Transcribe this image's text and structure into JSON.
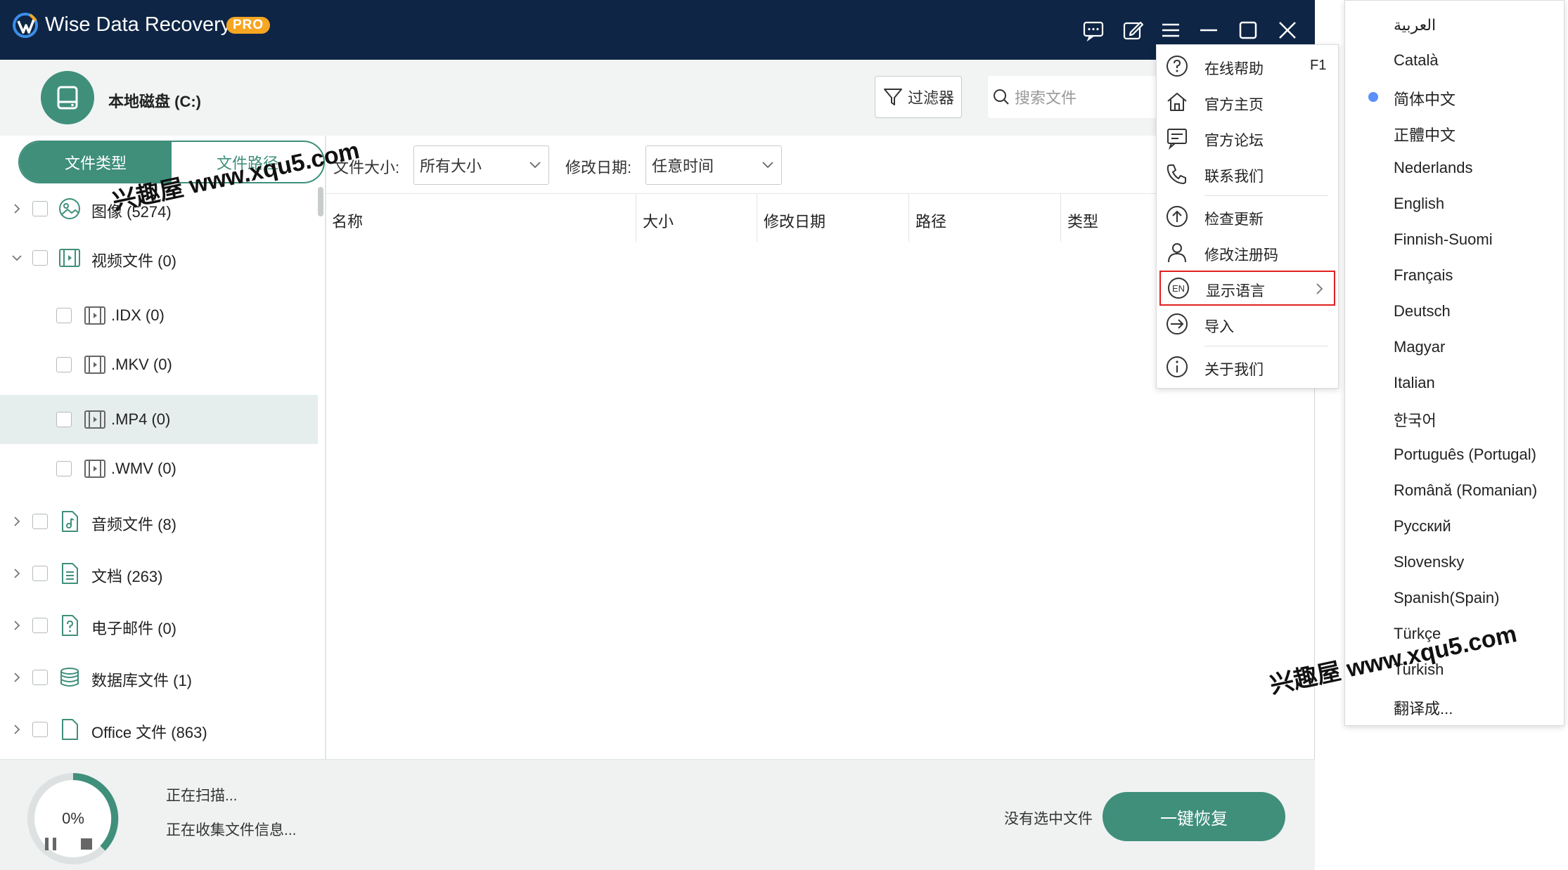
{
  "app": {
    "title": "Wise Data Recovery",
    "badge": "PRO"
  },
  "drive": {
    "title": "本地磁盘 (C:)"
  },
  "toolbar": {
    "filter_label": "过滤器",
    "search_placeholder": "搜索文件"
  },
  "tabs": [
    {
      "label": "文件类型"
    },
    {
      "label": "文件路径"
    }
  ],
  "tree": [
    {
      "label": "图像 (5274)"
    },
    {
      "label": "视频文件 (0)"
    },
    {
      "label": ".IDX (0)"
    },
    {
      "label": ".MKV (0)"
    },
    {
      "label": ".MP4 (0)"
    },
    {
      "label": ".WMV (0)"
    },
    {
      "label": "音频文件 (8)"
    },
    {
      "label": "文档 (263)"
    },
    {
      "label": "电子邮件 (0)"
    },
    {
      "label": "数据库文件 (1)"
    },
    {
      "label": "Office 文件 (863)"
    }
  ],
  "filters": {
    "size_label": "文件大小:",
    "size_value": "所有大小",
    "date_label": "修改日期:",
    "date_value": "任意时间"
  },
  "columns": [
    "名称",
    "大小",
    "修改日期",
    "路径",
    "类型"
  ],
  "scan": {
    "percent": "0%",
    "status1": "正在扫描...",
    "status2": "正在收集文件信息..."
  },
  "footer": {
    "no_selection": "没有选中文件",
    "recover_label": "一键恢复"
  },
  "menu": {
    "items": [
      {
        "label": "在线帮助",
        "shortcut": "F1"
      },
      {
        "label": "官方主页"
      },
      {
        "label": "官方论坛"
      },
      {
        "label": "联系我们"
      },
      {
        "label": "检查更新"
      },
      {
        "label": "修改注册码"
      },
      {
        "label": "显示语言"
      },
      {
        "label": "导入"
      },
      {
        "label": "关于我们"
      }
    ]
  },
  "languages": [
    "العربية",
    "Català",
    "简体中文",
    "正體中文",
    "Nederlands",
    "English",
    "Finnish-Suomi",
    "Français",
    "Deutsch",
    "Magyar",
    "Italian",
    "한국어",
    "Português (Portugal)",
    "Română (Romanian)",
    "Русский",
    "Slovensky",
    "Spanish(Spain)",
    "Türkçe",
    "Turkish",
    "翻译成..."
  ],
  "selected_language": "简体中文",
  "watermark": "兴趣屋 www.xqu5.com",
  "colors": {
    "titlebar": "#0e2545",
    "accent": "#3f8f7b",
    "badge": "#f6a623",
    "highlight_border": "#e02020"
  }
}
